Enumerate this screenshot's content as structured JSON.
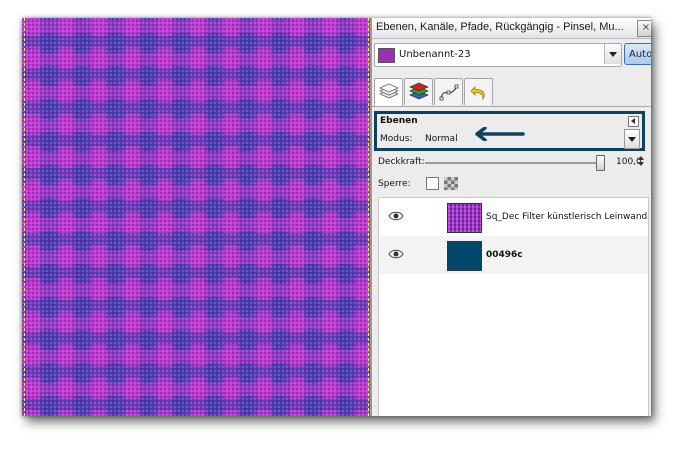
{
  "window_title": "Ebenen, Kanäle, Pfade, Rückgängig - Pinsel, Mu...",
  "close_glyph": "×",
  "image_selector": {
    "label": "Unbenannt-23",
    "swatch_color": "#9c2fb6"
  },
  "auto_button": "Auto",
  "tabs": [
    {
      "name": "layers",
      "icon": "layers-icon"
    },
    {
      "name": "channels",
      "icon": "channels-icon"
    },
    {
      "name": "paths",
      "icon": "paths-icon"
    },
    {
      "name": "undo",
      "icon": "undo-icon"
    }
  ],
  "layers_panel": {
    "title": "Ebenen",
    "mode_label": "Modus:",
    "mode_value": "Normal",
    "opacity_label": "Deckkraft:",
    "opacity_value": "100,0",
    "opacity_fraction": 1.0,
    "lock_label": "Sperre:",
    "layers": [
      {
        "name": "Sq_Dec Filter künstlerisch Leinwand",
        "bold": false,
        "thumb": "pattern"
      },
      {
        "name": "00496c",
        "bold": true,
        "thumb": "solid",
        "color": "#00496c"
      }
    ]
  },
  "colors": {
    "highlight_border": "#123f5e",
    "canvas_base": "#6a3fb5",
    "canvas_magenta": "#e33ad8",
    "canvas_blue": "#3b3fa8"
  }
}
